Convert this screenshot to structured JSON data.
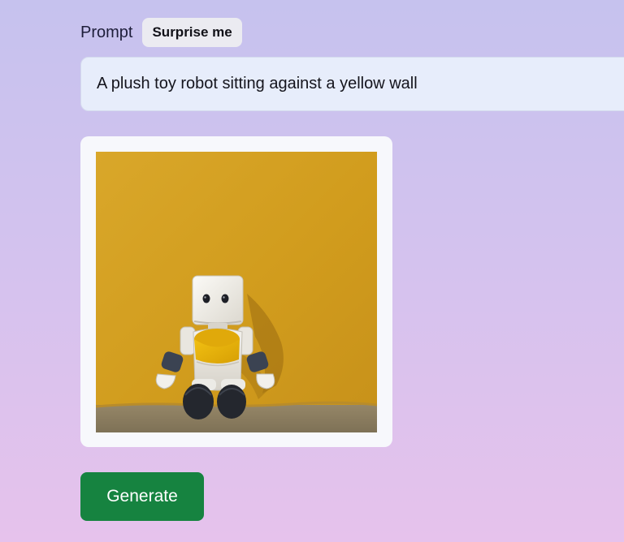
{
  "prompt": {
    "label": "Prompt",
    "surprise_label": "Surprise me",
    "value": "A plush toy robot sitting against a yellow wall"
  },
  "image": {
    "subject": "plush-toy-robot",
    "colors": {
      "wall": "#d4a021",
      "ground": "#8c7d5d",
      "robot_body": "#f0eeea",
      "robot_chest": "#e8b508",
      "robot_feet": "#22252b"
    }
  },
  "actions": {
    "generate_label": "Generate"
  },
  "colors": {
    "accent": "#168340",
    "input_bg": "#e7edfb"
  }
}
